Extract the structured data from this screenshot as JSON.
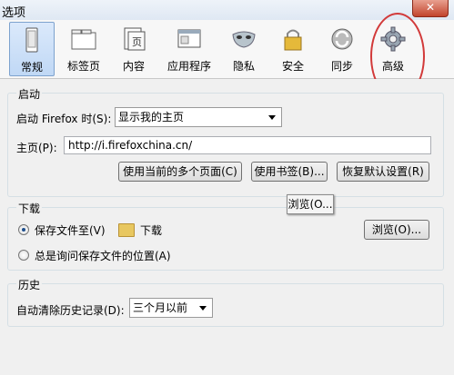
{
  "window": {
    "title": "选项",
    "close_symbol": "✕"
  },
  "toolbar": {
    "items": [
      {
        "label": "常规",
        "icon": "phone-icon",
        "selected": true
      },
      {
        "label": "标签页",
        "icon": "folder-tabs-icon"
      },
      {
        "label": "内容",
        "icon": "page-icon"
      },
      {
        "label": "应用程序",
        "icon": "window-icon"
      },
      {
        "label": "隐私",
        "icon": "mask-icon"
      },
      {
        "label": "安全",
        "icon": "lock-icon"
      },
      {
        "label": "同步",
        "icon": "sync-icon"
      },
      {
        "label": "高级",
        "icon": "gear-icon"
      }
    ]
  },
  "startup": {
    "group_label": "启动",
    "when_label": "启动 Firefox 时(S):",
    "when_value": "显示我的主页",
    "home_label": "主页(P):",
    "home_value": "http://i.firefoxchina.cn/",
    "btn_current": "使用当前的多个页面(C)",
    "btn_bookmark": "使用书签(B)...",
    "btn_restore": "恢复默认设置(R)"
  },
  "downloads": {
    "group_label": "下载",
    "save_label": "保存文件至(V)",
    "save_path": "下载",
    "browse": "浏览(O)...",
    "ask_label": "总是询问保存文件的位置(A)",
    "tooltip": "浏览(O..."
  },
  "history": {
    "group_label": "历史",
    "clear_label": "自动清除历史记录(D):",
    "clear_value": "三个月以前"
  },
  "colors": {
    "annotation": "#d23a3a",
    "selected": "#c0d8f5"
  }
}
